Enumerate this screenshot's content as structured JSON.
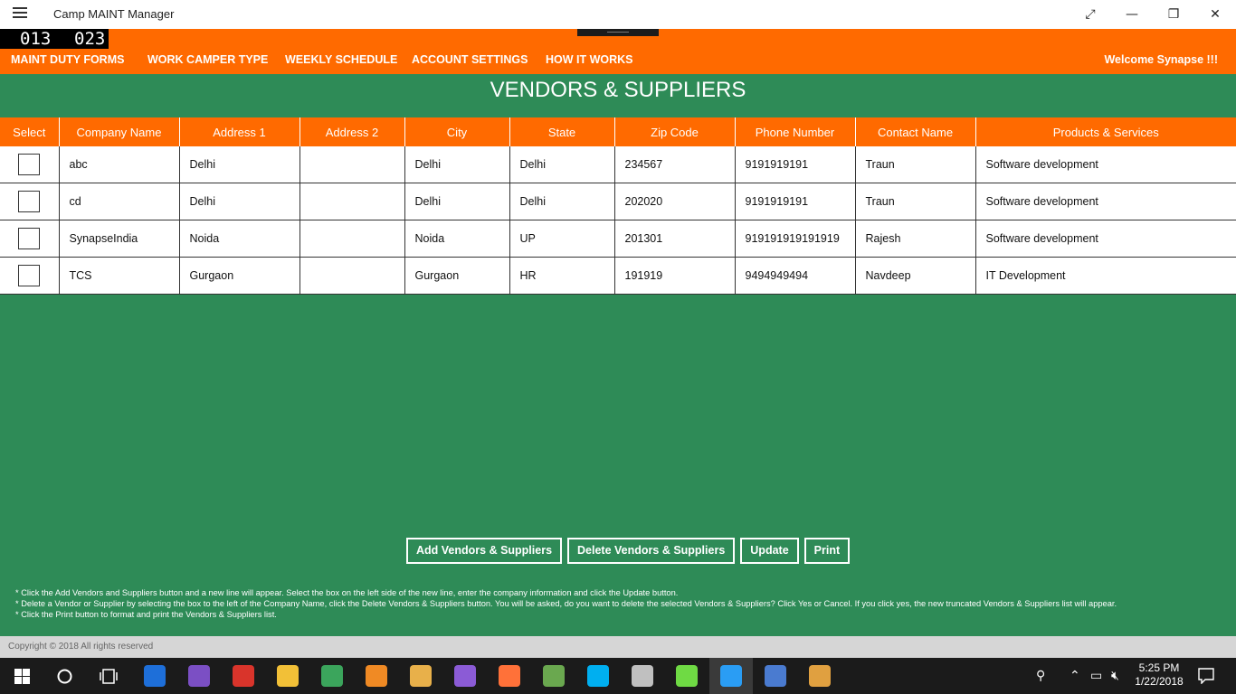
{
  "window": {
    "title": "Camp MAINT Manager",
    "buttons": [
      "⤢",
      "—",
      "❐",
      "✕"
    ]
  },
  "counter": {
    "left": "013",
    "right": "023"
  },
  "nav": {
    "items": [
      "MAINT DUTY FORMS",
      "WORK CAMPER TYPE",
      "WEEKLY SCHEDULE",
      "ACCOUNT SETTINGS",
      "HOW IT WORKS"
    ],
    "welcome": "Welcome  Synapse  !!!"
  },
  "page": {
    "title": "VENDORS & SUPPLIERS"
  },
  "table": {
    "headers": [
      "Select",
      "Company Name",
      "Address 1",
      "Address 2",
      "City",
      "State",
      "Zip Code",
      "Phone Number",
      "Contact Name",
      "Products & Services"
    ],
    "rows": [
      {
        "selected": false,
        "company": "abc",
        "address1": "Delhi",
        "address2": "",
        "city": "Delhi",
        "state": "Delhi",
        "zip": "234567",
        "phone": "9191919191",
        "contact": "Traun",
        "products": "Software development"
      },
      {
        "selected": false,
        "company": "cd",
        "address1": "Delhi",
        "address2": "",
        "city": "Delhi",
        "state": "Delhi",
        "zip": "202020",
        "phone": "9191919191",
        "contact": "Traun",
        "products": "Software development"
      },
      {
        "selected": false,
        "company": "SynapseIndia",
        "address1": "Noida",
        "address2": "",
        "city": "Noida",
        "state": "UP",
        "zip": "201301",
        "phone": "919191919191919",
        "contact": "Rajesh",
        "products": "Software development"
      },
      {
        "selected": false,
        "company": "TCS",
        "address1": "Gurgaon",
        "address2": "",
        "city": "Gurgaon",
        "state": "HR",
        "zip": "191919",
        "phone": "9494949494",
        "contact": "Navdeep",
        "products": "IT Development"
      }
    ]
  },
  "actions": {
    "add": "Add Vendors & Suppliers",
    "delete": "Delete Vendors & Suppliers",
    "update": "Update",
    "print": "Print"
  },
  "notes": [
    "*  Click the Add Vendors and Suppliers button and a new line will appear. Select the box on the left side of the new line, enter the company information and click the Update button.",
    "*  Delete a Vendor or Supplier by selecting the box to the left of the Company Name, click the Delete Vendors & Suppliers button. You will be asked, do you want to delete the selected Vendors & Suppliers? Click Yes or Cancel. If you click yes, the new truncated Vendors & Suppliers list will appear.",
    "*  Click the Print button to format and print the Vendors & Suppliers list."
  ],
  "footer": {
    "copyright": "Copyright © 2018 All rights reserved"
  },
  "taskbar": {
    "clock_time": "5:25 PM",
    "clock_date": "1/22/2018",
    "apps": [
      {
        "icon": "edge-icon",
        "color": "#1e6fd9"
      },
      {
        "icon": "cat-app-icon",
        "color": "#7b4fc4"
      },
      {
        "icon": "vc-app-icon",
        "color": "#d9342b"
      },
      {
        "icon": "file-explorer-icon",
        "color": "#f2c037"
      },
      {
        "icon": "chrome-icon",
        "color": "#3ba55c"
      },
      {
        "icon": "flame-app-icon",
        "color": "#f08a24"
      },
      {
        "icon": "mail-app-icon",
        "color": "#e8b04a"
      },
      {
        "icon": "visual-studio-icon",
        "color": "#8b5bd6"
      },
      {
        "icon": "firefox-icon",
        "color": "#ff7139"
      },
      {
        "icon": "photo-app-icon",
        "color": "#6aa84f"
      },
      {
        "icon": "skype-icon",
        "color": "#00aff0"
      },
      {
        "icon": "tools-app-icon",
        "color": "#c0c0c0"
      },
      {
        "icon": "upwork-icon",
        "color": "#6fda44"
      },
      {
        "icon": "camp-maint-icon",
        "color": "#2a9df4"
      },
      {
        "icon": "remote-desktop-icon",
        "color": "#4a7bd0"
      },
      {
        "icon": "paint-app-icon",
        "color": "#e0a040"
      }
    ]
  }
}
